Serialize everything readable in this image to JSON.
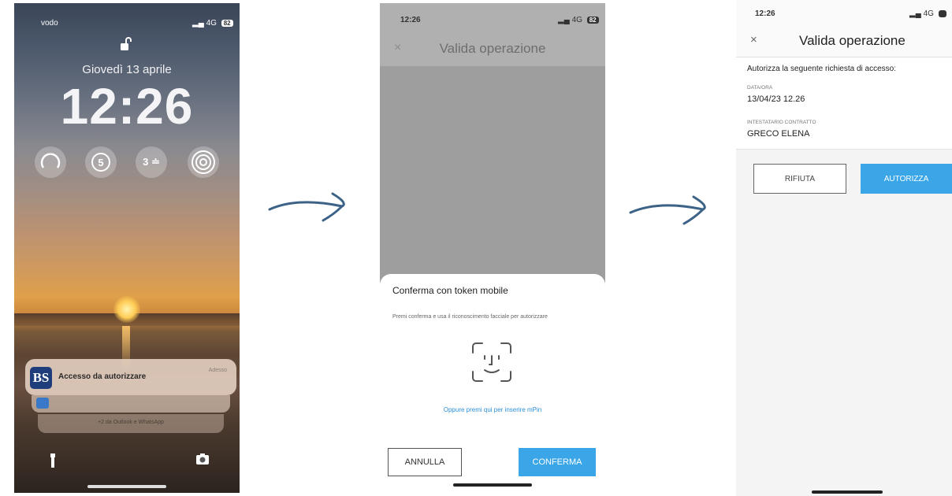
{
  "colors": {
    "accent": "#3aa6e8",
    "brand": "#1f3d7a"
  },
  "screen1": {
    "carrier": "vodo",
    "signal": "4G",
    "battery": "82",
    "date": "Giovedì 13 aprile",
    "time": "12:26",
    "widget_steps": "5",
    "widget_count": "3 ≐",
    "notification": {
      "app_logo": "BS",
      "title": "Accesso da autorizzare",
      "time": "Adesso",
      "more": "+2 da Outlook e WhatsApp"
    }
  },
  "screen2": {
    "time": "12:26",
    "signal": "4G",
    "battery": "82",
    "close": "×",
    "title": "Valida operazione",
    "sheet_title": "Conferma con token mobile",
    "sheet_desc": "Premi conferma e usa il riconoscimento facciale per autorizzare",
    "pin_link": "Oppure premi qui per inserire mPin",
    "cancel": "ANNULLA",
    "confirm": "CONFERMA"
  },
  "screen3": {
    "time": "12:26",
    "signal": "4G",
    "close": "×",
    "title": "Valida operazione",
    "request": "Autorizza la seguente richiesta di accesso:",
    "date_label": "DATA/ORA",
    "date_value": "13/04/23 12.26",
    "holder_label": "INTESTATARIO CONTRATTO",
    "holder_value": "GRECO ELENA",
    "reject": "RIFIUTA",
    "authorize": "AUTORIZZA"
  }
}
